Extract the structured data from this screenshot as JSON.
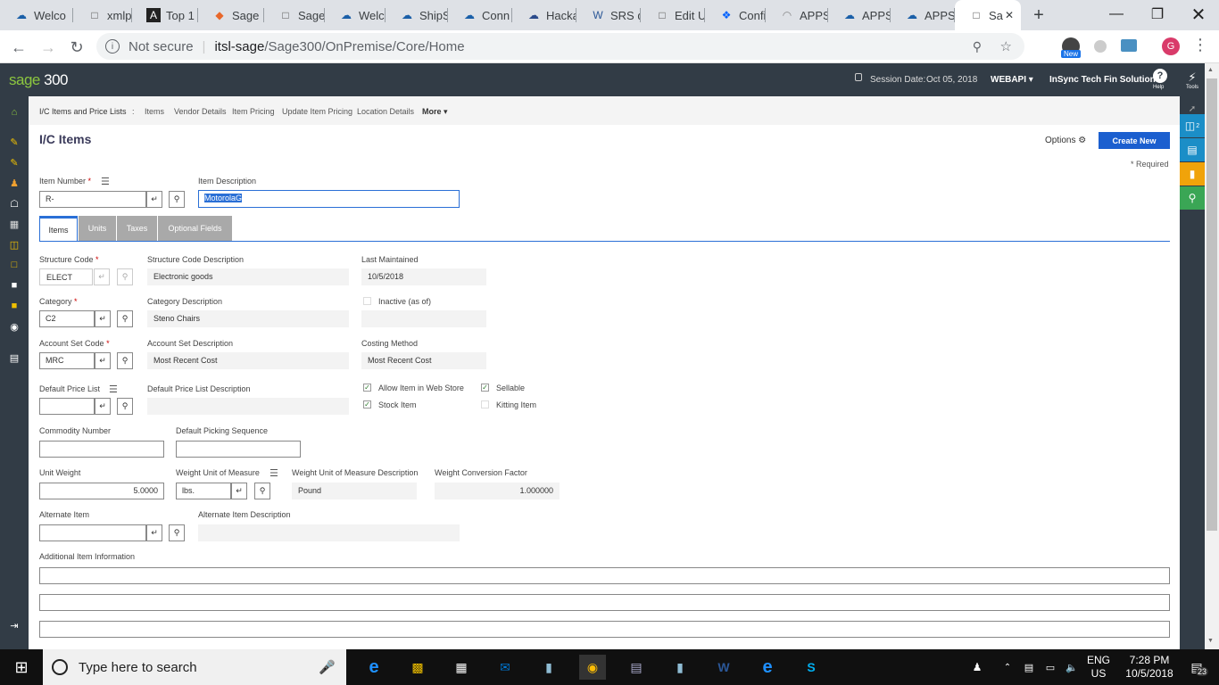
{
  "browser": {
    "tabs": [
      {
        "label": "Welco",
        "icon": "sage-icon"
      },
      {
        "label": "xmlpr",
        "icon": "doc-icon"
      },
      {
        "label": "Top 1",
        "icon": "a-icon"
      },
      {
        "label": "Sage",
        "icon": "sage-orange-icon"
      },
      {
        "label": "Sage",
        "icon": "doc-icon"
      },
      {
        "label": "Welco",
        "icon": "sage-icon"
      },
      {
        "label": "ShipS",
        "icon": "sage-icon"
      },
      {
        "label": "Conn",
        "icon": "sage-icon"
      },
      {
        "label": "Hacka",
        "icon": "cloud-icon"
      },
      {
        "label": "SRS d",
        "icon": "word-icon"
      },
      {
        "label": "Edit U",
        "icon": "doc-icon"
      },
      {
        "label": "Confi",
        "icon": "dropbox-icon"
      },
      {
        "label": "APPS",
        "icon": "loading-icon"
      },
      {
        "label": "APPS",
        "icon": "sage-icon"
      },
      {
        "label": "APPS",
        "icon": "sage-icon"
      },
      {
        "label": "Sa",
        "icon": "doc-icon"
      }
    ],
    "not_secure": "Not secure",
    "url_host": "itsl-sage",
    "url_path": "/Sage300/OnPremise/Core/Home",
    "profile_initial": "G",
    "ext_badge": "New"
  },
  "header": {
    "logo_sage": "sage",
    "logo_num": "300",
    "session_label": "Session Date:",
    "session_date": "Oct 05, 2018",
    "company": "WEBAPI",
    "org": "InSync Tech Fin Solution",
    "help": "Help",
    "tools": "Tools"
  },
  "breadcrumb": {
    "root": "I/C Items and Price Lists",
    "sep": ":",
    "items": [
      "Items",
      "Vendor Details",
      "Item Pricing",
      "Update Item Pricing",
      "Location Details"
    ],
    "more": "More"
  },
  "page": {
    "title": "I/C Items",
    "options": "Options",
    "create_new": "Create New",
    "required_note": "* Required"
  },
  "item": {
    "number_label": "Item Number",
    "number_value": "R-",
    "desc_label": "Item Description",
    "desc_value": "MotorolaG"
  },
  "tabs": [
    "Items",
    "Units",
    "Taxes",
    "Optional Fields"
  ],
  "fields": {
    "structure_code_label": "Structure Code",
    "structure_code": "ELECT",
    "structure_desc_label": "Structure Code Description",
    "structure_desc": "Electronic goods",
    "last_maint_label": "Last Maintained",
    "last_maint": "10/5/2018",
    "category_label": "Category",
    "category": "C2",
    "category_desc_label": "Category Description",
    "category_desc": "Steno Chairs",
    "inactive_label": "Inactive (as of)",
    "account_set_label": "Account Set Code",
    "account_set": "MRC",
    "account_set_desc_label": "Account Set Description",
    "account_set_desc": "Most Recent Cost",
    "costing_label": "Costing Method",
    "costing": "Most Recent Cost",
    "price_list_label": "Default Price List",
    "price_list_desc_label": "Default Price List Description",
    "web_store_label": "Allow Item in Web Store",
    "sellable_label": "Sellable",
    "stock_label": "Stock Item",
    "kitting_label": "Kitting Item",
    "commodity_label": "Commodity Number",
    "picking_label": "Default Picking Sequence",
    "unit_weight_label": "Unit Weight",
    "unit_weight": "5.0000",
    "weight_uom_label": "Weight Unit of Measure",
    "weight_uom": "lbs.",
    "weight_uom_desc_label": "Weight Unit of Measure Description",
    "weight_uom_desc": "Pound",
    "conv_label": "Weight Conversion Factor",
    "conv": "1.000000",
    "alt_item_label": "Alternate Item",
    "alt_item_desc_label": "Alternate Item Description",
    "additional_label": "Additional Item Information"
  },
  "checkboxes": {
    "web_store": true,
    "sellable": true,
    "stock": true,
    "kitting": false,
    "inactive": false
  },
  "right_panel_badge": "2",
  "taskbar": {
    "search_placeholder": "Type here to search",
    "lang1": "ENG",
    "lang2": "US",
    "time": "7:28 PM",
    "date": "10/5/2018",
    "notif_count": "23"
  }
}
